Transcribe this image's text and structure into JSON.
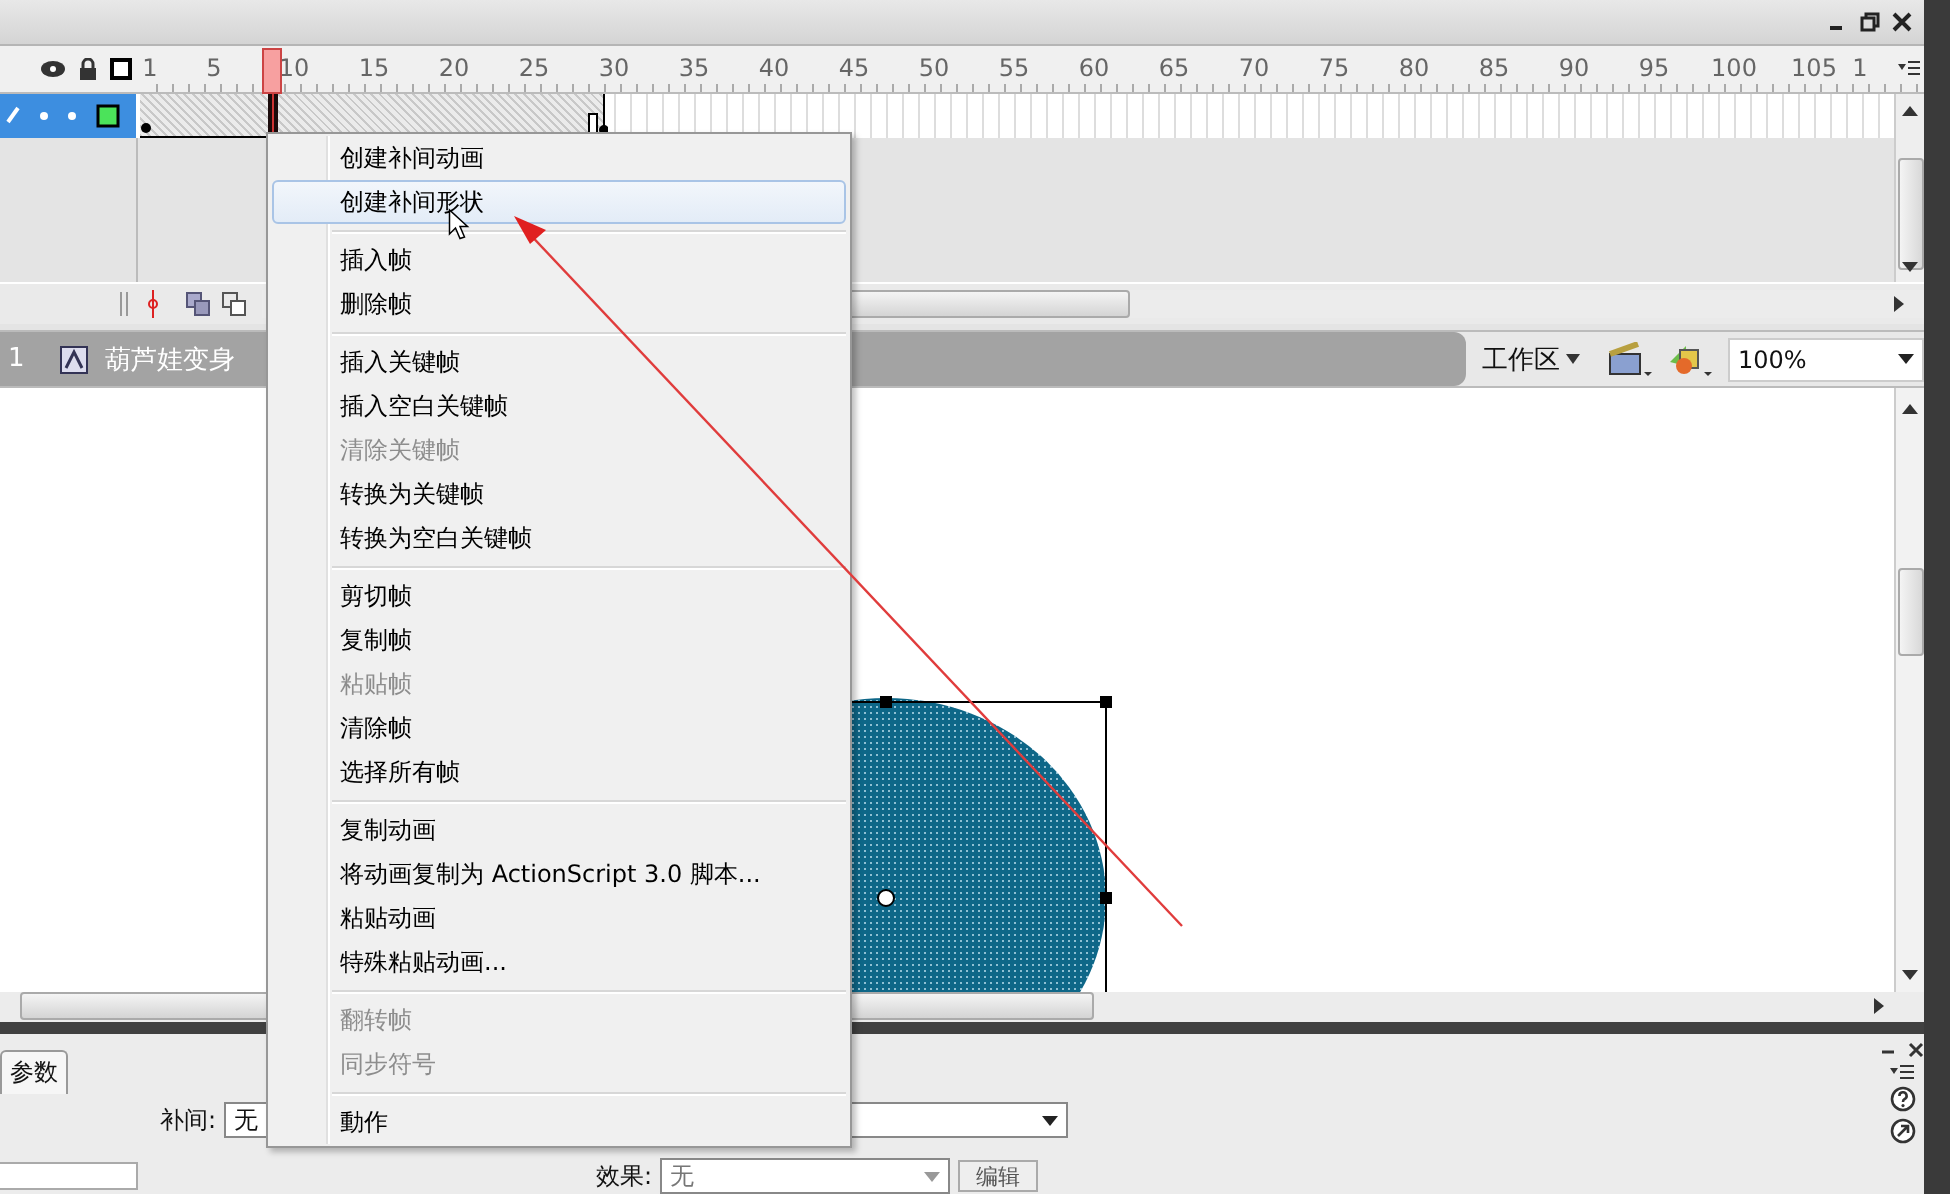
{
  "timeline": {
    "ruler": [
      "1",
      "5",
      "10",
      "15",
      "20",
      "25",
      "30",
      "35",
      "40",
      "45",
      "50",
      "55",
      "60",
      "65",
      "70",
      "75",
      "80",
      "85",
      "90",
      "95",
      "100",
      "105",
      "1"
    ],
    "layers": [
      {
        "selected": true
      }
    ]
  },
  "scene_bar": {
    "scene": "1",
    "symbol": "葫芦娃变身",
    "workspace": "工作区",
    "zoom": "100%"
  },
  "context_menu": {
    "groups": [
      [
        {
          "label": "创建补间动画",
          "disabled": false,
          "selected": false
        },
        {
          "label": "创建补间形状",
          "disabled": false,
          "selected": true
        }
      ],
      [
        {
          "label": "插入帧",
          "disabled": false,
          "selected": false
        },
        {
          "label": "删除帧",
          "disabled": false,
          "selected": false
        }
      ],
      [
        {
          "label": "插入关键帧",
          "disabled": false,
          "selected": false
        },
        {
          "label": "插入空白关键帧",
          "disabled": false,
          "selected": false
        },
        {
          "label": "清除关键帧",
          "disabled": true,
          "selected": false
        },
        {
          "label": "转换为关键帧",
          "disabled": false,
          "selected": false
        },
        {
          "label": "转换为空白关键帧",
          "disabled": false,
          "selected": false
        }
      ],
      [
        {
          "label": "剪切帧",
          "disabled": false,
          "selected": false
        },
        {
          "label": "复制帧",
          "disabled": false,
          "selected": false
        },
        {
          "label": "粘贴帧",
          "disabled": true,
          "selected": false
        },
        {
          "label": "清除帧",
          "disabled": false,
          "selected": false
        },
        {
          "label": "选择所有帧",
          "disabled": false,
          "selected": false
        }
      ],
      [
        {
          "label": "复制动画",
          "disabled": false,
          "selected": false
        },
        {
          "label": "将动画复制为 ActionScript 3.0 脚本...",
          "disabled": false,
          "selected": false
        },
        {
          "label": "粘贴动画",
          "disabled": false,
          "selected": false
        },
        {
          "label": "特殊粘贴动画...",
          "disabled": false,
          "selected": false
        }
      ],
      [
        {
          "label": "翻转帧",
          "disabled": true,
          "selected": false
        },
        {
          "label": "同步符号",
          "disabled": true,
          "selected": false
        }
      ],
      [
        {
          "label": "動作",
          "disabled": false,
          "selected": false
        }
      ]
    ]
  },
  "properties": {
    "tabs": [
      {
        "label": "参数",
        "selected": true
      }
    ],
    "tween_label": "补间:",
    "tween_value": "无",
    "effect_label": "效果:",
    "effect_value": "无",
    "edit_button": "编辑"
  }
}
